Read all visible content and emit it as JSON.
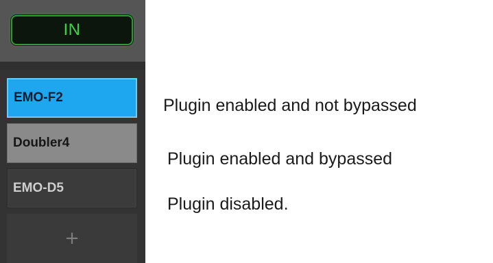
{
  "rack": {
    "input_button": {
      "label": "IN",
      "color": "#3cd14a"
    },
    "slots": [
      {
        "label": "EMO-F2",
        "state": "enabled-not-bypassed",
        "color": "#1ea7ee"
      },
      {
        "label": "Doubler4",
        "state": "enabled-bypassed",
        "color": "#8a8a8a"
      },
      {
        "label": "EMO-D5",
        "state": "disabled",
        "color": "#3b3b3b"
      }
    ],
    "add_slot": {
      "label": "+"
    }
  },
  "annotations": [
    "Plugin enabled and not bypassed",
    "Plugin enabled and bypassed",
    "Plugin disabled."
  ]
}
